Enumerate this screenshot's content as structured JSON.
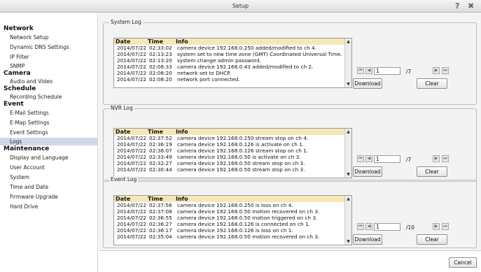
{
  "window": {
    "title": "Setup",
    "help_icon": "?",
    "close_icon": "✖"
  },
  "sidebar": {
    "groups": [
      {
        "label": "Network",
        "items": [
          "Network Setup",
          "Dynamic DNS Settings",
          "IP Filter",
          "SNMP"
        ]
      },
      {
        "label": "Camera",
        "items": [
          "Audio and Video"
        ]
      },
      {
        "label": "Schedule",
        "items": [
          "Recording Schedule"
        ]
      },
      {
        "label": "Event",
        "items": [
          "E-Mail Settings",
          "E-Map Settings",
          "Event Settings",
          "Logs"
        ]
      },
      {
        "label": "Maintenance",
        "items": [
          "Display and Language",
          "User Account",
          "System",
          "Time and Date",
          "Firmware Upgrade",
          "Hard Drive"
        ]
      }
    ],
    "selected": "Logs"
  },
  "columns": {
    "date": "Date",
    "time": "Time",
    "info": "Info"
  },
  "system_log": {
    "title": "System Log",
    "rows": [
      [
        "2014/07/22",
        "02:33:02",
        "camera device 192.168.0.250 added/modified to ch 4."
      ],
      [
        "2014/07/22",
        "02:13:23",
        "system set to new time zone (GMT) Coordinated Universal Time."
      ],
      [
        "2014/07/22",
        "02:13:20",
        "system change admin password."
      ],
      [
        "2014/07/22",
        "02:08:33",
        "camera device 192.168.0.43 added/modified to ch 2."
      ],
      [
        "2014/07/22",
        "02:08:20",
        "network set to DHCP."
      ],
      [
        "2014/07/22",
        "02:08:20",
        "network port connected."
      ]
    ],
    "page": "1",
    "total": "/7",
    "download_label": "Download",
    "clear_label": "Clear"
  },
  "nvr_log": {
    "title": "NVR Log",
    "rows": [
      [
        "2014/07/22",
        "02:37:52",
        "camera device 192.168.0.250 stream stop on ch 4."
      ],
      [
        "2014/07/22",
        "02:36:19",
        "camera device 192.168.0.126 is activate on ch 1."
      ],
      [
        "2014/07/22",
        "02:36:07",
        "camera device 192.168.0.126 stream stop on ch 1."
      ],
      [
        "2014/07/22",
        "02:33:49",
        "camera device 192.168.0.50 is activate on ch 3."
      ],
      [
        "2014/07/22",
        "02:32:27",
        "camera device 192.168.0.50 stream stop on ch 3."
      ],
      [
        "2014/07/22",
        "02:30:44",
        "camera device 192.168.0.50 stream stop on ch 3."
      ]
    ],
    "page": "1",
    "total": "/7",
    "download_label": "Download",
    "clear_label": "Clear"
  },
  "event_log": {
    "title": "Event Log",
    "rows": [
      [
        "2014/07/22",
        "02:37:56",
        "camera device 192.168.0.250 is loss on ch 4."
      ],
      [
        "2014/07/22",
        "02:37:08",
        "camera device 192.168.0.50 motion recovered on ch 3."
      ],
      [
        "2014/07/22",
        "02:36:55",
        "camera device 192.168.0.50 motion triggered on ch 3."
      ],
      [
        "2014/07/22",
        "02:36:27",
        "camera device 192.168.0.126 is connected on ch 1."
      ],
      [
        "2014/07/22",
        "02:36:17",
        "camera device 192.168.0.126 is loss on ch 1."
      ],
      [
        "2014/07/22",
        "02:35:04",
        "camera device 192.168.0.50 motion recovered on ch 3."
      ]
    ],
    "page": "1",
    "total": "/10",
    "download_label": "Download",
    "clear_label": "Clear"
  },
  "footer": {
    "cancel_label": "Cancel"
  }
}
